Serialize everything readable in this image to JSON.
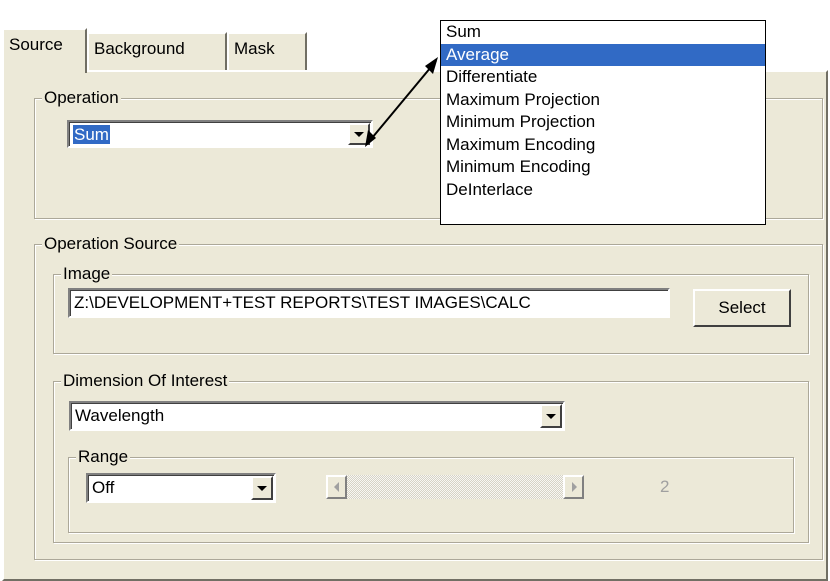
{
  "tabs": [
    {
      "label": "Source",
      "active": true
    },
    {
      "label": "Background",
      "active": false
    },
    {
      "label": "Mask",
      "active": false
    }
  ],
  "operation": {
    "legend": "Operation",
    "selected": "Sum",
    "options": [
      "Sum",
      "Average",
      "Differentiate",
      "Maximum Projection",
      "Minimum Projection",
      "Maximum Encoding",
      "Minimum Encoding",
      "DeInterlace"
    ],
    "highlighted_option": "Average"
  },
  "operation_source": {
    "legend": "Operation Source",
    "image": {
      "legend": "Image",
      "path": "Z:\\DEVELOPMENT+TEST REPORTS\\TEST IMAGES\\CALC",
      "select_label": "Select"
    },
    "dimension": {
      "legend": "Dimension Of Interest",
      "value": "Wavelength",
      "range": {
        "legend": "Range",
        "value": "Off",
        "readout": "2"
      }
    }
  },
  "icons": {
    "dropdown_arrow": "chevron-down-icon",
    "scroll_left": "scroll-left-arrow-icon",
    "scroll_right": "scroll-right-arrow-icon",
    "annotation": "annotation-arrow-icon"
  },
  "colors": {
    "selection": "#316ac5",
    "panel": "#ece9d8",
    "disabled_text": "#a0a0a0"
  }
}
